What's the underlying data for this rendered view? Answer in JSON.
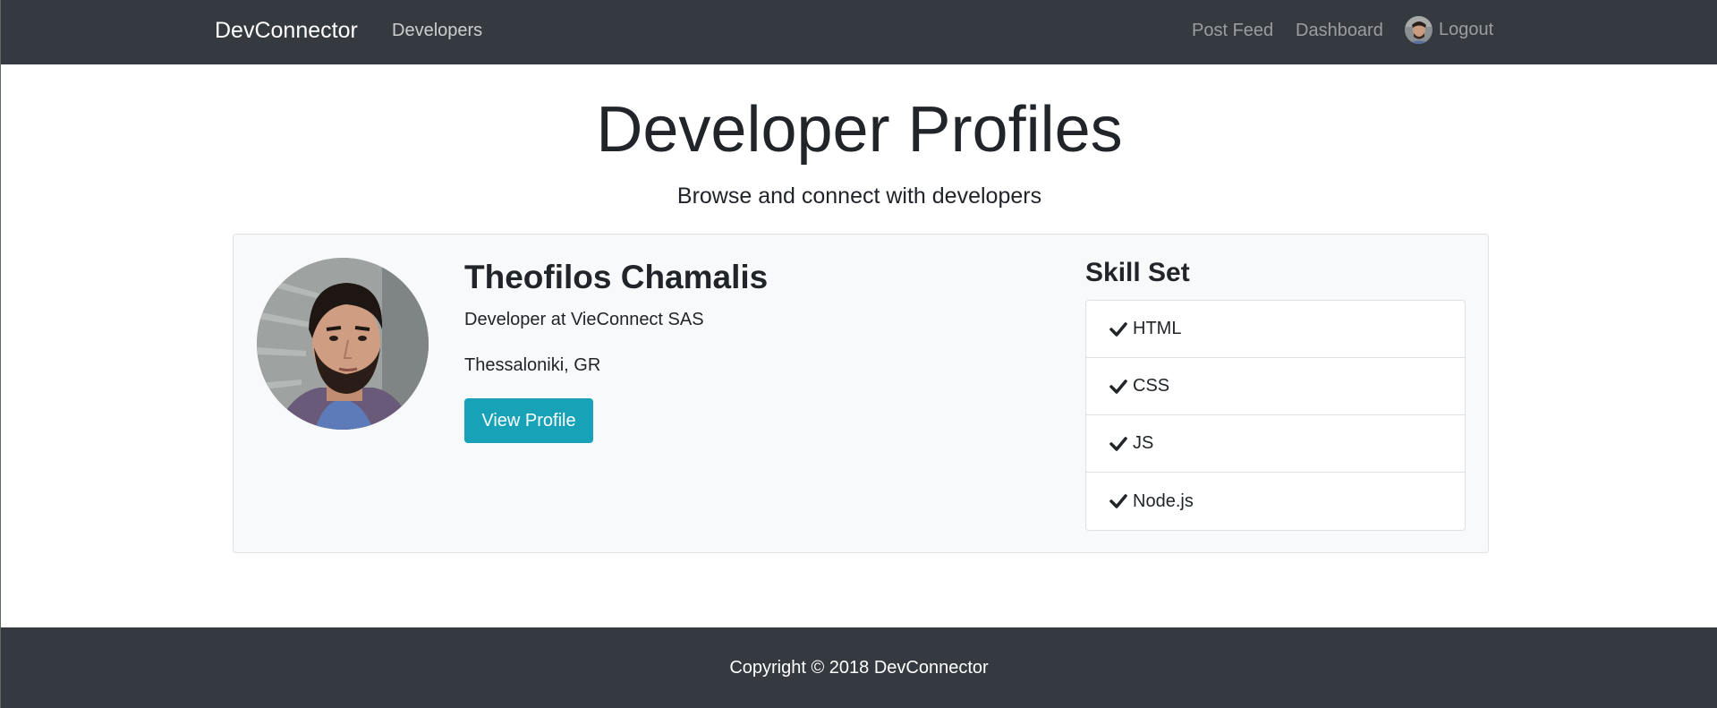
{
  "navbar": {
    "brand": "DevConnector",
    "developers_link": "Developers",
    "post_feed_link": "Post Feed",
    "dashboard_link": "Dashboard",
    "logout_link": "Logout"
  },
  "header": {
    "title": "Developer Profiles",
    "lead": "Browse and connect with developers"
  },
  "profiles": [
    {
      "name": "Theofilos Chamalis",
      "status": "Developer at VieConnect SAS",
      "location": "Thessaloniki, GR",
      "view_button": "View Profile",
      "skills_title": "Skill Set",
      "skills": [
        "HTML",
        "CSS",
        "JS",
        "Node.js"
      ]
    }
  ],
  "footer": {
    "copyright": "Copyright © 2018 DevConnector"
  },
  "colors": {
    "navbar_bg": "#343a40",
    "button_info": "#17a2b8",
    "card_bg": "#f8f9fa"
  }
}
